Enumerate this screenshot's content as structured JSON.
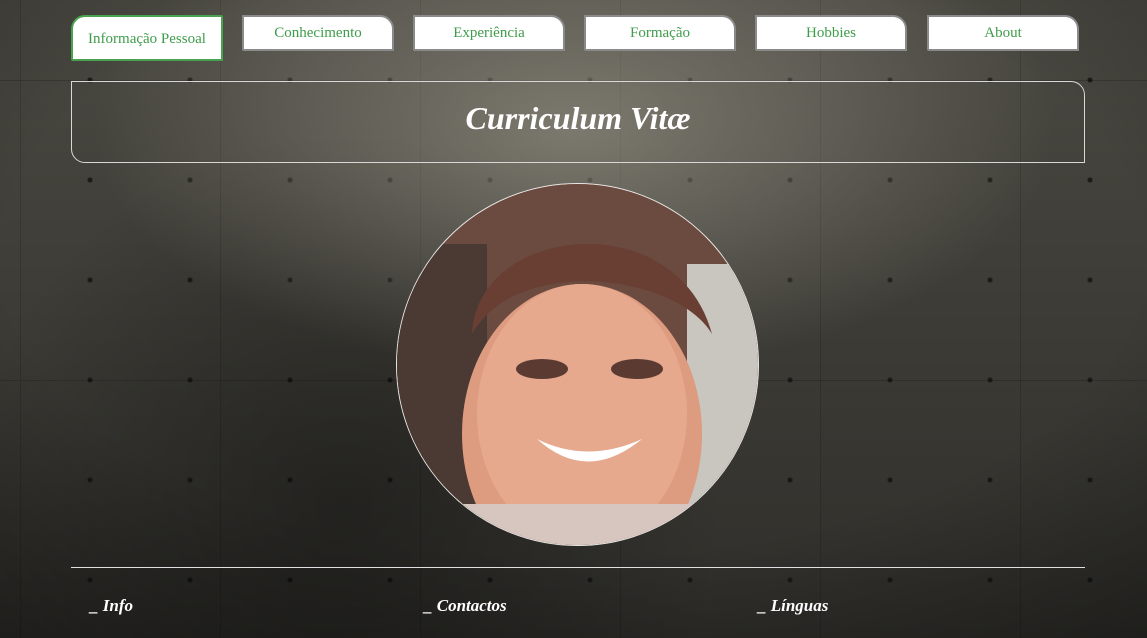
{
  "nav": {
    "tabs": [
      {
        "label": "Informação Pessoal",
        "active": true
      },
      {
        "label": "Conhecimento",
        "active": false
      },
      {
        "label": "Experiência",
        "active": false
      },
      {
        "label": "Formação",
        "active": false
      },
      {
        "label": "Hobbies",
        "active": false
      },
      {
        "label": "About",
        "active": false
      }
    ]
  },
  "header": {
    "title": "Curriculum Vitæ"
  },
  "sections": [
    {
      "title": "_ Info"
    },
    {
      "title": "_ Contactos"
    },
    {
      "title": "_ Línguas"
    }
  ],
  "colors": {
    "accent": "#3f9c4a",
    "tab_border": "#8a8a8a",
    "text": "#ffffff"
  }
}
